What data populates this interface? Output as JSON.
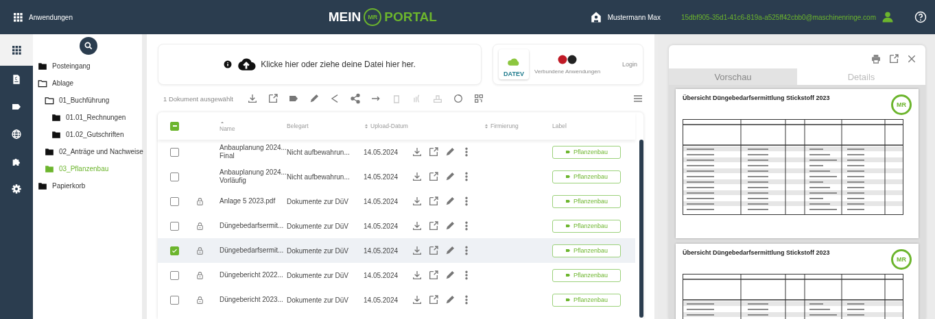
{
  "header": {
    "apps_label": "Anwendungen",
    "logo": {
      "left": "MEIN",
      "mark": "MR",
      "right": "PORTAL"
    },
    "user_name": "Mustermann Max",
    "email": "15dbf905-35d1-41c6-819a-a525ff42cbb0@maschinenringe.com"
  },
  "rail": [
    {
      "kind": "grid",
      "selected": true
    },
    {
      "kind": "document",
      "selected": false
    },
    {
      "kind": "tag",
      "selected": false
    },
    {
      "kind": "globe",
      "selected": false
    },
    {
      "kind": "puzzle",
      "selected": false
    },
    {
      "kind": "gear",
      "selected": false
    }
  ],
  "tree": [
    {
      "label": "Posteingang",
      "expanded": false,
      "selected": false
    },
    {
      "label": "Ablage",
      "expanded": true,
      "selected": false,
      "children": [
        {
          "label": "01_Buchführung",
          "expanded": true,
          "selected": false,
          "children": [
            {
              "label": "01.01_Rechnungen",
              "expanded": false,
              "selected": false
            },
            {
              "label": "01.02_Gutschriften",
              "expanded": false,
              "selected": false
            }
          ]
        },
        {
          "label": "02_Anträge und Nachweise",
          "expanded": false,
          "selected": false
        },
        {
          "label": "03_Pflanzenbau",
          "expanded": false,
          "selected": true
        }
      ]
    },
    {
      "label": "Papierkorb",
      "expanded": false,
      "selected": false
    }
  ],
  "upload": {
    "text": "Klicke hier oder ziehe deine Datei hier her."
  },
  "connected": {
    "logo_text": "DATEV",
    "caption": "Verbundene Anwendungen",
    "login": "Login"
  },
  "toolbar": {
    "selection_text": "1 Dokument ausgewählt"
  },
  "table": {
    "select_all_indeterminate": true,
    "columns": [
      {
        "label": "Name",
        "sorted": true
      },
      {
        "label": "Belegart"
      },
      {
        "label": "Upload-Datum",
        "sorted": false
      },
      {
        "label": "Firmierung",
        "sorted": false
      },
      {
        "label": "Label"
      }
    ],
    "rows": [
      {
        "checked": false,
        "locked": false,
        "name": "Anbauplanung 2024...\nFinal",
        "type": "Nicht aufbewahrun...",
        "date": "14.05.2024",
        "label": "Pflanzenbau"
      },
      {
        "checked": false,
        "locked": false,
        "name": "Anbauplanung 2024...\nVorläufig",
        "type": "Nicht aufbewahrun...",
        "date": "14.05.2024",
        "label": "Pflanzenbau"
      },
      {
        "checked": false,
        "locked": true,
        "name": "Anlage 5 2023.pdf",
        "type": "Dokumente zur DüV",
        "date": "14.05.2024",
        "label": "Pflanzenbau"
      },
      {
        "checked": false,
        "locked": true,
        "name": "Düngebedarfsermit...",
        "type": "Dokumente zur DüV",
        "date": "14.05.2024",
        "label": "Pflanzenbau"
      },
      {
        "checked": true,
        "locked": true,
        "name": "Düngebedarfsermit...",
        "type": "Dokumente zur DüV",
        "date": "14.05.2024",
        "label": "Pflanzenbau"
      },
      {
        "checked": false,
        "locked": true,
        "name": "Düngebericht 2022...",
        "type": "Dokumente zur DüV",
        "date": "14.05.2024",
        "label": "Pflanzenbau"
      },
      {
        "checked": false,
        "locked": true,
        "name": "Düngebericht 2023...",
        "type": "Dokumente zur DüV",
        "date": "14.05.2024",
        "label": "Pflanzenbau"
      }
    ]
  },
  "preview": {
    "tabs": [
      {
        "label": "Vorschau",
        "selected": true
      },
      {
        "label": "Details",
        "selected": false
      }
    ],
    "pages": [
      {
        "title": "Übersicht Düngebedarfsermittlung Stickstoff 2023",
        "logo": "MR"
      },
      {
        "title": "Übersicht Düngebedarfsermittlung Stickstoff 2023",
        "logo": "MR"
      }
    ]
  }
}
